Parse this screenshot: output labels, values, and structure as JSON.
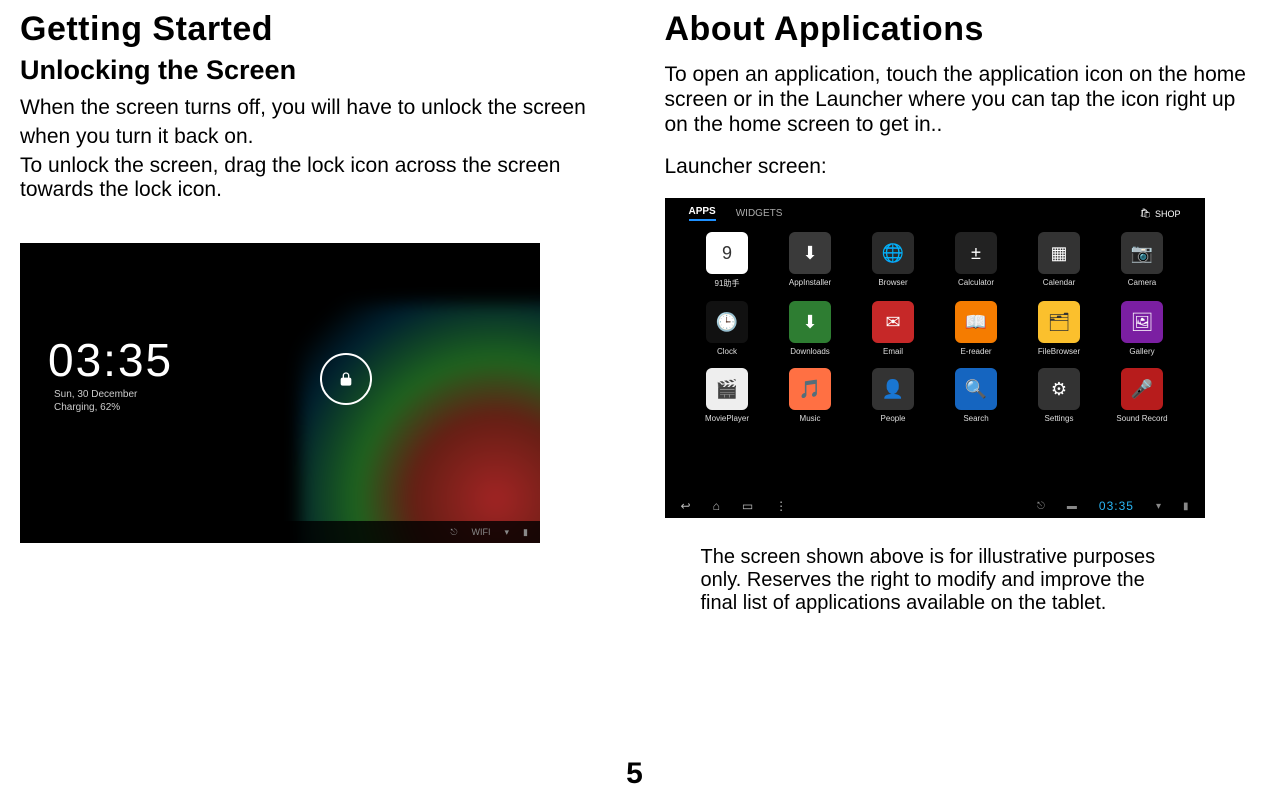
{
  "left": {
    "h1": "Getting Started",
    "h2": "Unlocking the Screen",
    "p1": "When the screen turns off, you will have to unlock the screen",
    "p2": "when you turn it back on.",
    "p3": "To unlock the screen, drag the lock icon across the screen towards the lock icon."
  },
  "lockscreen": {
    "time": "03:35",
    "date": "Sun, 30 December",
    "charging": "Charging, 62%",
    "sys_wifi": "WIFI",
    "sys_batt": "▮"
  },
  "right": {
    "h1": "About Applications",
    "p1": "To open an application, touch the application icon on the home screen or in the Launcher where you can tap the icon right up on the home screen to get in..",
    "p2": "Launcher screen:"
  },
  "launcher": {
    "tab_apps": "APPS",
    "tab_widgets": "WIDGETS",
    "shop": "SHOP",
    "nav_time": "03:35",
    "apps": [
      {
        "name": "91助手",
        "bg": "#ffffff",
        "glyph": "9"
      },
      {
        "name": "AppInstaller",
        "bg": "#3a3a3a",
        "glyph": "⬇"
      },
      {
        "name": "Browser",
        "bg": "#2a2a2a",
        "glyph": "🌐"
      },
      {
        "name": "Calculator",
        "bg": "#222",
        "glyph": "±"
      },
      {
        "name": "Calendar",
        "bg": "#333",
        "glyph": "▦"
      },
      {
        "name": "Camera",
        "bg": "#333",
        "glyph": "📷"
      },
      {
        "name": "Clock",
        "bg": "#111",
        "glyph": "🕒"
      },
      {
        "name": "Downloads",
        "bg": "#2e7d32",
        "glyph": "⬇"
      },
      {
        "name": "Email",
        "bg": "#c62828",
        "glyph": "✉"
      },
      {
        "name": "E-reader",
        "bg": "#f57c00",
        "glyph": "📖"
      },
      {
        "name": "FileBrowser",
        "bg": "#fbc02d",
        "glyph": "🗂"
      },
      {
        "name": "Gallery",
        "bg": "#7b1fa2",
        "glyph": "🖼"
      },
      {
        "name": "MoviePlayer",
        "bg": "#eeeeee",
        "glyph": "🎬"
      },
      {
        "name": "Music",
        "bg": "#ff7043",
        "glyph": "🎵"
      },
      {
        "name": "People",
        "bg": "#333",
        "glyph": "👤"
      },
      {
        "name": "Search",
        "bg": "#1565c0",
        "glyph": "🔍"
      },
      {
        "name": "Settings",
        "bg": "#333",
        "glyph": "⚙"
      },
      {
        "name": "Sound Record",
        "bg": "#b71c1c",
        "glyph": "🎤"
      }
    ]
  },
  "footnote": "The screen shown above is for illustrative purposes only. Reserves the right to modify and improve the final list of applications available on the tablet.",
  "pagenum": "5"
}
